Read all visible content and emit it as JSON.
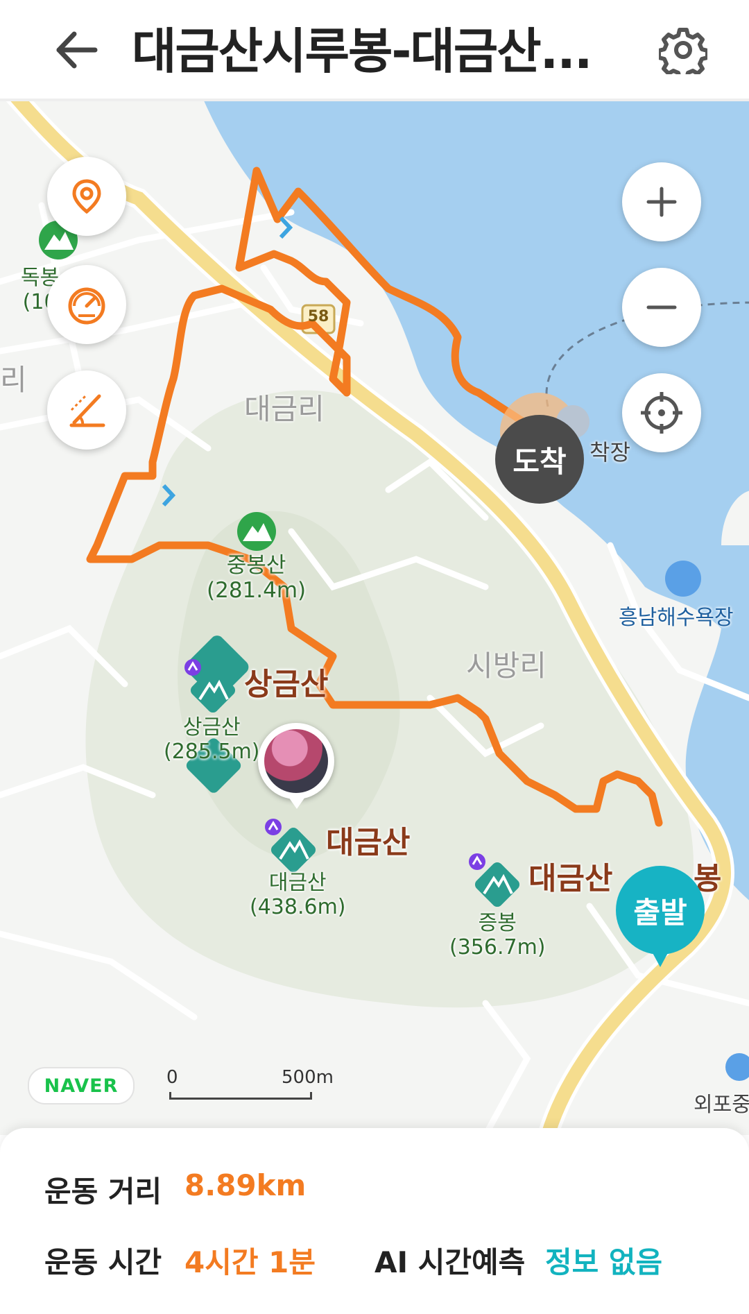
{
  "header": {
    "title": "대금산시루봉-대금산...",
    "back_icon": "arrow-left-icon",
    "settings_icon": "gear-icon"
  },
  "map_controls": {
    "left": [
      "location-pin-icon",
      "speedometer-icon",
      "elevation-slope-icon"
    ],
    "right": [
      "zoom-in-icon",
      "zoom-out-icon",
      "crosshair-locate-icon"
    ]
  },
  "map_labels": {
    "dokbong_name": "독봉",
    "dokbong_height": "(10",
    "ri_left": "리",
    "road_number": "58",
    "daegeum_ri": "대금리",
    "harbor": "착장",
    "arrive": "도착",
    "jungbongsan_name": "중봉산",
    "jungbongsan_height": "(281.4m)",
    "heungnam_beach": "흥남해수욕장",
    "sibang_ri": "시방리",
    "sanggeumsan_peak": "상금산",
    "sanggeumsan_name": "상금산",
    "sanggeumsan_height": "(285.5m)",
    "daegeumsan_peak": "대금산",
    "daegeumsan_name": "대금산",
    "daegeumsan_height": "(438.6m)",
    "jeungbong_peak": "대금산",
    "jeungbong_peak_tail": "봉",
    "jeungbong_name": "증봉",
    "jeungbong_height": "(356.7m)",
    "start": "출발",
    "oepo": "외포중",
    "naver": "NAVER",
    "scale_zero": "0",
    "scale_distance": "500m"
  },
  "colors": {
    "route": "#f37b21",
    "arrive_pin": "#4b4b4b",
    "start_pin": "#17b3c4",
    "water": "#a5cff0",
    "road_major": "#f5dd8e"
  },
  "stats": {
    "distance_label": "운동 거리",
    "distance_value": "8.89km",
    "time_label": "운동 시간",
    "time_value": "4시간 1분",
    "ai_label": "AI 시간예측",
    "ai_value": "정보 없음"
  }
}
